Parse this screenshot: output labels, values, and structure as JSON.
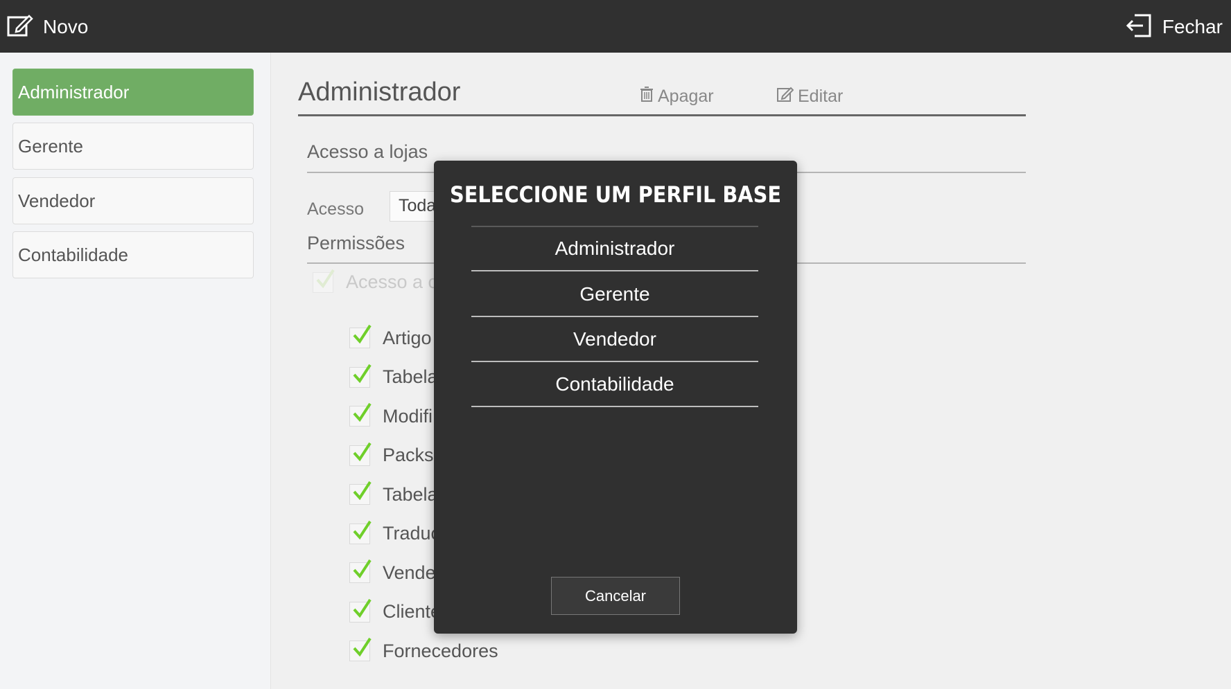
{
  "topbar": {
    "new_label": "Novo",
    "new_icon": "edit-icon",
    "close_label": "Fechar",
    "close_icon": "exit-icon"
  },
  "sidebar": {
    "items": [
      {
        "label": "Administrador",
        "active": true
      },
      {
        "label": "Gerente",
        "active": false
      },
      {
        "label": "Vendedor",
        "active": false
      },
      {
        "label": "Contabilidade",
        "active": false
      }
    ],
    "active_color": "#70ad64"
  },
  "main": {
    "title": "Administrador",
    "delete_label": "Apagar",
    "edit_label": "Editar",
    "store_access_title": "Acesso a lojas",
    "access_label": "Acesso",
    "access_value": "Todas",
    "permissions_title": "Permissões",
    "permission_parent": "Acesso a c",
    "permissions": [
      "Artigo",
      "Tabela",
      "Modifi",
      "Packs",
      "Tabela",
      "Traduç",
      "Vende",
      "Cliente",
      "Fornecedores"
    ]
  },
  "modal": {
    "title": "Seleccione um perfil base",
    "options": [
      "Administrador",
      "Gerente",
      "Vendedor",
      "Contabilidade"
    ],
    "cancel_label": "Cancelar"
  },
  "colors": {
    "topbar": "#303030",
    "check_green": "#6fcf2a",
    "modal_bg": "#303030"
  }
}
